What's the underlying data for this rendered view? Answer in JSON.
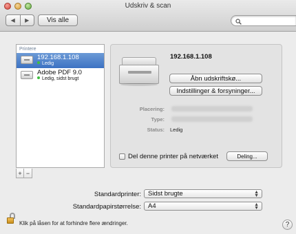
{
  "window": {
    "title": "Udskriv & scan"
  },
  "toolbar": {
    "back_icon": "◀",
    "forward_icon": "▶",
    "show_all_label": "Vis alle",
    "search_icon": "🔍",
    "search_placeholder": ""
  },
  "printer_list": {
    "header": "Printere",
    "items": [
      {
        "name": "192.168.1.108",
        "status": "Ledig",
        "status_color": "#3fbf3f",
        "selected": true
      },
      {
        "name": "Adobe PDF 9.0",
        "status": "Ledig, sidst brugt",
        "status_color": "#3fbf3f",
        "selected": false
      }
    ],
    "add_label": "+",
    "remove_label": "−"
  },
  "detail": {
    "printer_name": "192.168.1.108",
    "open_queue_label": "Åbn udskriftskø...",
    "options_label": "Indstillinger & forsyninger...",
    "location_label": "Placering:",
    "type_label": "Type:",
    "status_label": "Status:",
    "status_value": "Ledig",
    "share_label": "Del denne printer på netværket",
    "share_checked": false,
    "sharing_button_label": "Deling..."
  },
  "defaults": {
    "default_printer_label": "Standardprinter:",
    "default_printer_value": "Sidst brugte",
    "default_paper_label": "Standardpapirstørrelse:",
    "default_paper_value": "A4"
  },
  "footer": {
    "lock_text": "Klik på låsen for at forhindre flere ændringer.",
    "help_label": "?"
  },
  "colors": {
    "selection": "#3c72c3",
    "status_dot": "#3fbf3f"
  }
}
